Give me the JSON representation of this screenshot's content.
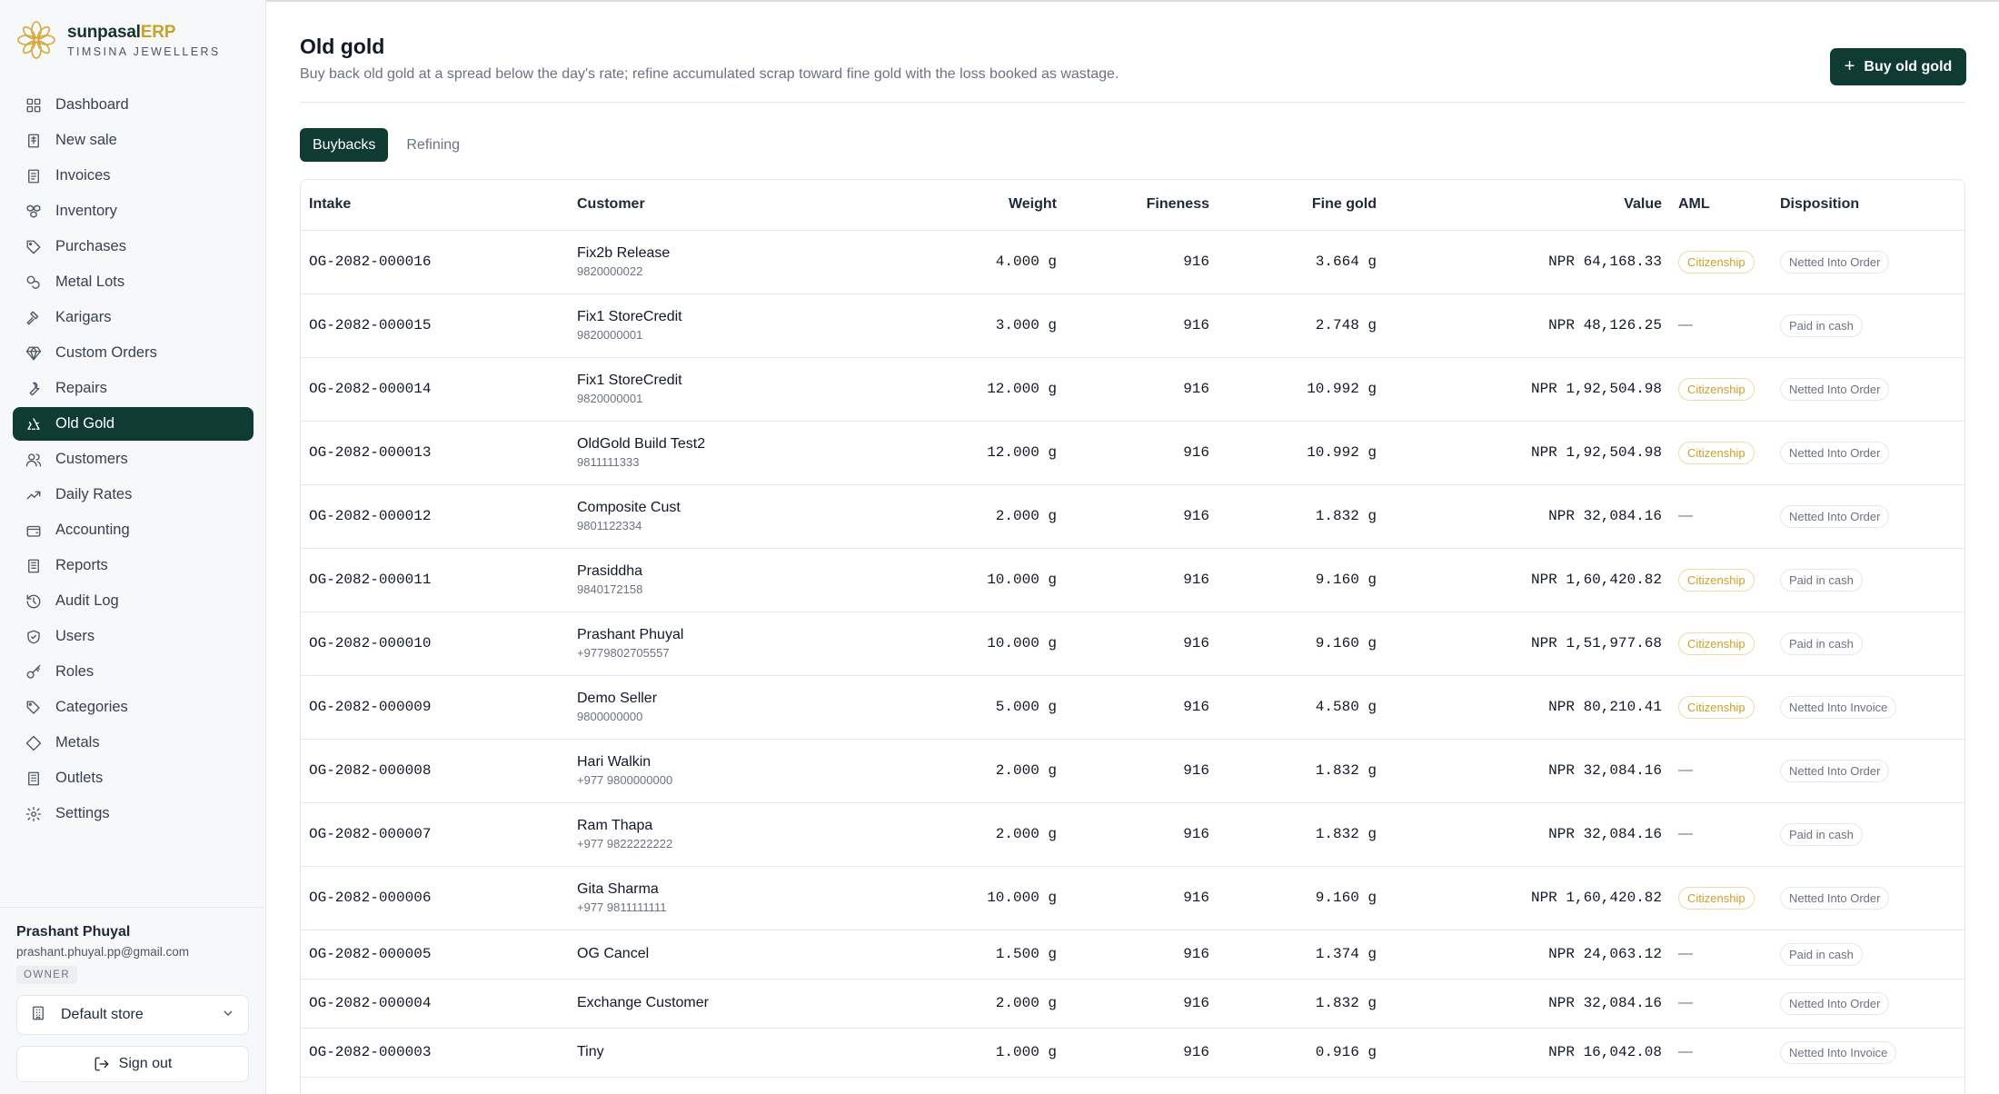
{
  "brand": {
    "name_main": "sunpasal",
    "name_accent": "ERP",
    "subtitle": "TIMSINA JEWELLERS"
  },
  "sidebar": {
    "items": [
      {
        "label": "Dashboard",
        "icon": "grid-icon"
      },
      {
        "label": "New sale",
        "icon": "receipt-icon"
      },
      {
        "label": "Invoices",
        "icon": "file-icon"
      },
      {
        "label": "Inventory",
        "icon": "boxes-icon"
      },
      {
        "label": "Purchases",
        "icon": "tag-icon"
      },
      {
        "label": "Metal Lots",
        "icon": "coins-icon"
      },
      {
        "label": "Karigars",
        "icon": "hammer-icon"
      },
      {
        "label": "Custom Orders",
        "icon": "gem-icon"
      },
      {
        "label": "Repairs",
        "icon": "wrench-icon"
      },
      {
        "label": "Old Gold",
        "icon": "recycle-icon",
        "active": true
      },
      {
        "label": "Customers",
        "icon": "users-icon"
      },
      {
        "label": "Daily Rates",
        "icon": "trend-icon"
      },
      {
        "label": "Accounting",
        "icon": "wallet-icon"
      },
      {
        "label": "Reports",
        "icon": "report-icon"
      },
      {
        "label": "Audit Log",
        "icon": "history-icon"
      },
      {
        "label": "Users",
        "icon": "shield-icon"
      },
      {
        "label": "Roles",
        "icon": "key-icon"
      },
      {
        "label": "Categories",
        "icon": "tags-icon"
      },
      {
        "label": "Metals",
        "icon": "diamond-icon"
      },
      {
        "label": "Outlets",
        "icon": "building-icon"
      },
      {
        "label": "Settings",
        "icon": "gear-icon"
      }
    ]
  },
  "user": {
    "name": "Prashant Phuyal",
    "email": "prashant.phuyal.pp@gmail.com",
    "role": "OWNER",
    "store": "Default store",
    "sign_out": "Sign out"
  },
  "header": {
    "title": "Old gold",
    "subtitle": "Buy back old gold at a spread below the day's rate; refine accumulated scrap toward fine gold with the loss booked as wastage.",
    "primary_button": "Buy old gold"
  },
  "tabs": [
    {
      "label": "Buybacks",
      "active": true
    },
    {
      "label": "Refining",
      "active": false
    }
  ],
  "table": {
    "columns": {
      "intake": "Intake",
      "customer": "Customer",
      "weight": "Weight",
      "fineness": "Fineness",
      "fine_gold": "Fine gold",
      "value": "Value",
      "aml": "AML",
      "disposition": "Disposition"
    },
    "rows": [
      {
        "intake": "OG-2082-000016",
        "customer": "Fix2b Release",
        "phone": "9820000022",
        "weight": "4.000 g",
        "fineness": "916",
        "fine_gold": "3.664 g",
        "value": "NPR 64,168.33",
        "aml": "Citizenship",
        "disposition": "Netted Into Order"
      },
      {
        "intake": "OG-2082-000015",
        "customer": "Fix1 StoreCredit",
        "phone": "9820000001",
        "weight": "3.000 g",
        "fineness": "916",
        "fine_gold": "2.748 g",
        "value": "NPR 48,126.25",
        "aml": "—",
        "disposition": "Paid in cash"
      },
      {
        "intake": "OG-2082-000014",
        "customer": "Fix1 StoreCredit",
        "phone": "9820000001",
        "weight": "12.000 g",
        "fineness": "916",
        "fine_gold": "10.992 g",
        "value": "NPR 1,92,504.98",
        "aml": "Citizenship",
        "disposition": "Netted Into Order"
      },
      {
        "intake": "OG-2082-000013",
        "customer": "OldGold Build Test2",
        "phone": "9811111333",
        "weight": "12.000 g",
        "fineness": "916",
        "fine_gold": "10.992 g",
        "value": "NPR 1,92,504.98",
        "aml": "Citizenship",
        "disposition": "Netted Into Order"
      },
      {
        "intake": "OG-2082-000012",
        "customer": "Composite Cust",
        "phone": "9801122334",
        "weight": "2.000 g",
        "fineness": "916",
        "fine_gold": "1.832 g",
        "value": "NPR 32,084.16",
        "aml": "—",
        "disposition": "Netted Into Order"
      },
      {
        "intake": "OG-2082-000011",
        "customer": "Prasiddha",
        "phone": "9840172158",
        "weight": "10.000 g",
        "fineness": "916",
        "fine_gold": "9.160 g",
        "value": "NPR 1,60,420.82",
        "aml": "Citizenship",
        "disposition": "Paid in cash"
      },
      {
        "intake": "OG-2082-000010",
        "customer": "Prashant Phuyal",
        "phone": "+9779802705557",
        "weight": "10.000 g",
        "fineness": "916",
        "fine_gold": "9.160 g",
        "value": "NPR 1,51,977.68",
        "aml": "Citizenship",
        "disposition": "Paid in cash"
      },
      {
        "intake": "OG-2082-000009",
        "customer": "Demo Seller",
        "phone": "9800000000",
        "weight": "5.000 g",
        "fineness": "916",
        "fine_gold": "4.580 g",
        "value": "NPR 80,210.41",
        "aml": "Citizenship",
        "disposition": "Netted Into Invoice"
      },
      {
        "intake": "OG-2082-000008",
        "customer": "Hari Walkin",
        "phone": "+977 9800000000",
        "weight": "2.000 g",
        "fineness": "916",
        "fine_gold": "1.832 g",
        "value": "NPR 32,084.16",
        "aml": "—",
        "disposition": "Netted Into Order"
      },
      {
        "intake": "OG-2082-000007",
        "customer": "Ram Thapa",
        "phone": "+977 9822222222",
        "weight": "2.000 g",
        "fineness": "916",
        "fine_gold": "1.832 g",
        "value": "NPR 32,084.16",
        "aml": "—",
        "disposition": "Paid in cash"
      },
      {
        "intake": "OG-2082-000006",
        "customer": "Gita Sharma",
        "phone": "+977 9811111111",
        "weight": "10.000 g",
        "fineness": "916",
        "fine_gold": "9.160 g",
        "value": "NPR 1,60,420.82",
        "aml": "Citizenship",
        "disposition": "Netted Into Order"
      },
      {
        "intake": "OG-2082-000005",
        "customer": "OG Cancel",
        "phone": "",
        "weight": "1.500 g",
        "fineness": "916",
        "fine_gold": "1.374 g",
        "value": "NPR 24,063.12",
        "aml": "—",
        "disposition": "Paid in cash"
      },
      {
        "intake": "OG-2082-000004",
        "customer": "Exchange Customer",
        "phone": "",
        "weight": "2.000 g",
        "fineness": "916",
        "fine_gold": "1.832 g",
        "value": "NPR 32,084.16",
        "aml": "—",
        "disposition": "Netted Into Order"
      },
      {
        "intake": "OG-2082-000003",
        "customer": "Tiny",
        "phone": "",
        "weight": "1.000 g",
        "fineness": "916",
        "fine_gold": "0.916 g",
        "value": "NPR 16,042.08",
        "aml": "—",
        "disposition": "Netted Into Invoice"
      }
    ]
  },
  "colors": {
    "primary": "#0f3b32",
    "accent_gold": "#c9a227",
    "border": "#e5e7eb",
    "muted_text": "#6b7280"
  }
}
